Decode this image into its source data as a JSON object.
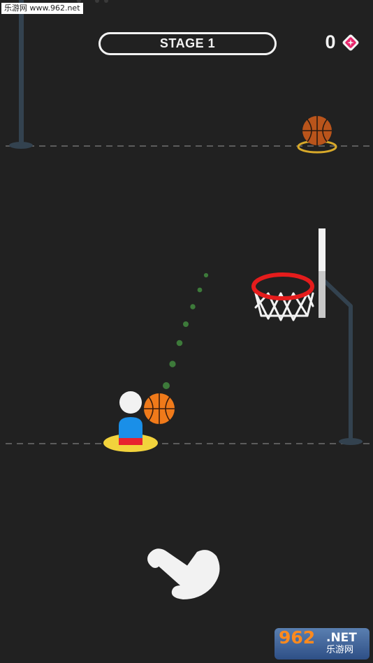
{
  "hud": {
    "stage_label": "STAGE 1",
    "gem_count": "0",
    "gem_color": "#e8256b"
  },
  "scene": {
    "background_color": "#212121",
    "ball_color": "#f07a1a",
    "rim_color": "#e51c1c",
    "pad_color": "#f2d33c",
    "player_body_color": "#1a8fe8",
    "player_shorts_color": "#e8232e",
    "aim_dots_color": "#3d7a3a",
    "icons": [
      "basketball-icon",
      "hoop-icon",
      "pointing-hand-icon",
      "gem-icon"
    ]
  },
  "watermark": {
    "top_text": "乐游网 www.962.net",
    "logo_number": "962",
    "logo_suffix": ".NET",
    "logo_cn": "乐游网"
  }
}
